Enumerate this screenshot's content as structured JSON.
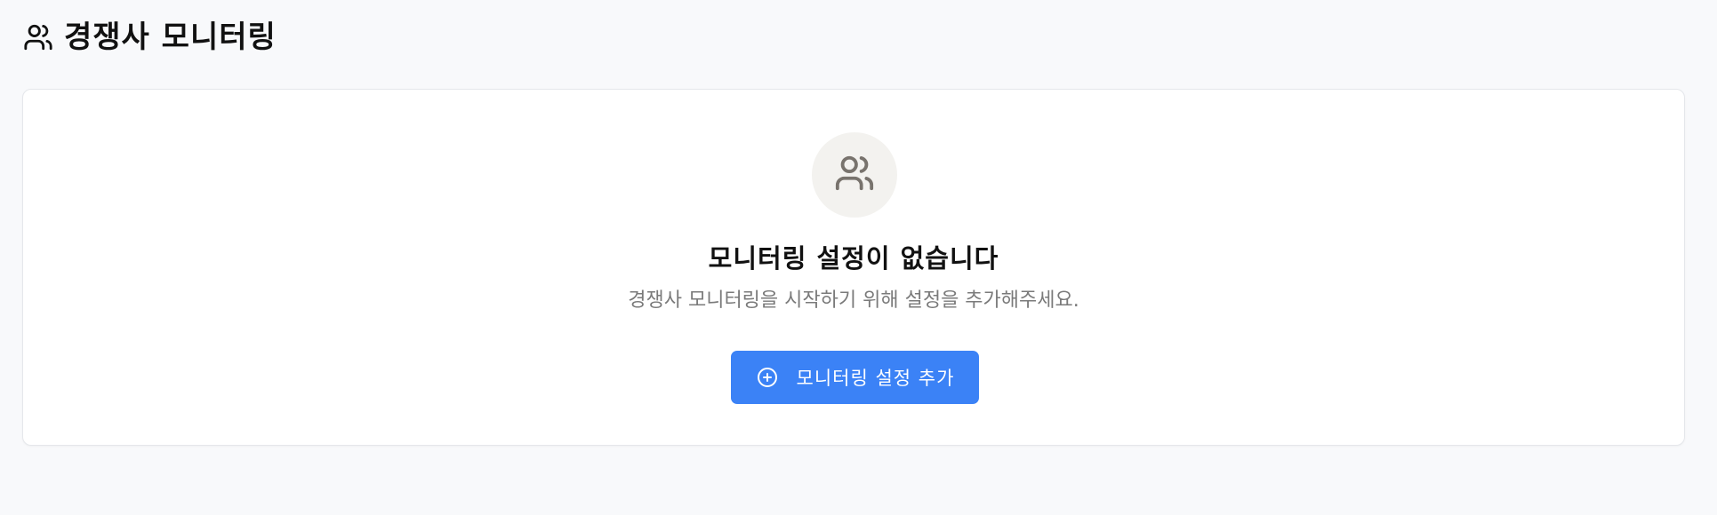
{
  "header": {
    "icon": "users-icon",
    "title": "경쟁사 모니터링"
  },
  "empty_state": {
    "icon": "users-icon",
    "title": "모니터링 설정이 없습니다",
    "description": "경쟁사 모니터링을 시작하기 위해 설정을 추가해주세요.",
    "button": {
      "icon": "plus-circle-icon",
      "label": "모니터링 설정 추가"
    }
  },
  "colors": {
    "background": "#f8f9fb",
    "card": "#ffffff",
    "primary": "#3b82f6",
    "icon_circle": "#f3f2ef",
    "icon_muted": "#78736d",
    "text_muted": "#7a7a7a"
  }
}
